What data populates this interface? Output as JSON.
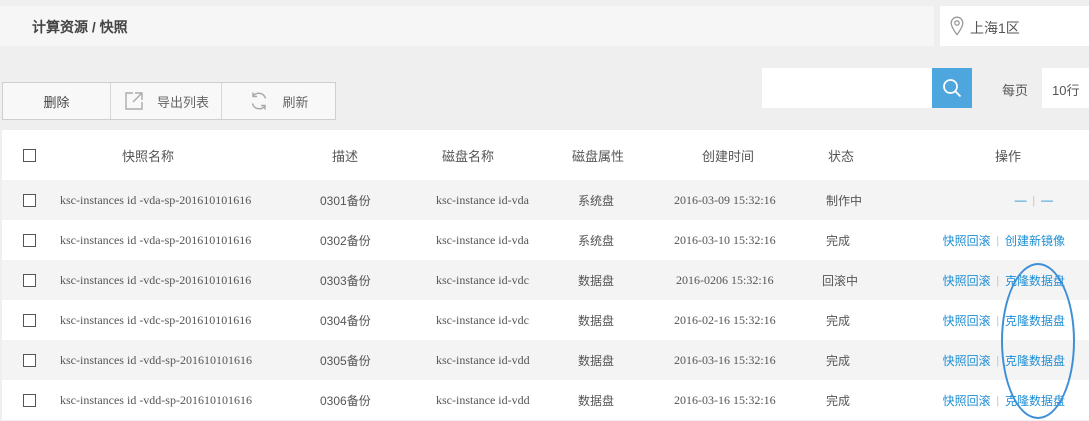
{
  "header": {
    "breadcrumb": "计算资源 / 快照",
    "region": "上海1区"
  },
  "toolbar": {
    "delete_label": "删除",
    "export_label": "导出列表",
    "refresh_label": "刷新"
  },
  "search": {
    "value": ""
  },
  "pagination": {
    "per_page_label": "每页",
    "per_page_value": "10行"
  },
  "table": {
    "columns": [
      "快照名称",
      "描述",
      "磁盘名称",
      "磁盘属性",
      "创建时间",
      "状态",
      "操作"
    ],
    "rows": [
      {
        "name": "ksc-instances id -vda-sp-201610101616",
        "desc": "0301备份",
        "disk": "ksc-instance id-vda",
        "attr": "系统盘",
        "time": "2016-03-09 15:32:16",
        "status": "制作中",
        "op1": "—",
        "sep": "|",
        "op2": "—"
      },
      {
        "name": "ksc-instances id -vda-sp-201610101616",
        "desc": "0302备份",
        "disk": "ksc-instance id-vda",
        "attr": "系统盘",
        "time": "2016-03-10 15:32:16",
        "status": "完成",
        "op1": "快照回滚",
        "sep": "|",
        "op2": "创建新镜像"
      },
      {
        "name": "ksc-instances id -vdc-sp-201610101616",
        "desc": "0303备份",
        "disk": "ksc-instance id-vdc",
        "attr": "数据盘",
        "time": "2016-0206 15:32:16",
        "status": "回滚中",
        "op1": "快照回滚",
        "sep": "|",
        "op2": "克隆数据盘"
      },
      {
        "name": "ksc-instances id -vdc-sp-201610101616",
        "desc": "0304备份",
        "disk": "ksc-instance id-vdc",
        "attr": "数据盘",
        "time": "2016-02-16 15:32:16",
        "status": "完成",
        "op1": "快照回滚",
        "sep": "|",
        "op2": "克隆数据盘"
      },
      {
        "name": "ksc-instances id -vdd-sp-201610101616",
        "desc": "0305备份",
        "disk": "ksc-instance id-vdd",
        "attr": "数据盘",
        "time": "2016-03-16 15:32:16",
        "status": "完成",
        "op1": "快照回滚",
        "sep": "|",
        "op2": "克隆数据盘"
      },
      {
        "name": "ksc-instances id -vdd-sp-201610101616",
        "desc": "0306备份",
        "disk": "ksc-instance id-vdd",
        "attr": "数据盘",
        "time": "2016-03-16 15:32:16",
        "status": "完成",
        "op1": "快照回滚",
        "sep": "|",
        "op2": "克隆数据盘"
      }
    ]
  },
  "colors": {
    "accent": "#4ea6df",
    "link": "#1e8ed4",
    "annotation": "#3f8fd8"
  },
  "icons": {
    "region": "location-pin-icon",
    "export": "export-icon",
    "refresh": "refresh-icon",
    "search": "search-icon"
  }
}
